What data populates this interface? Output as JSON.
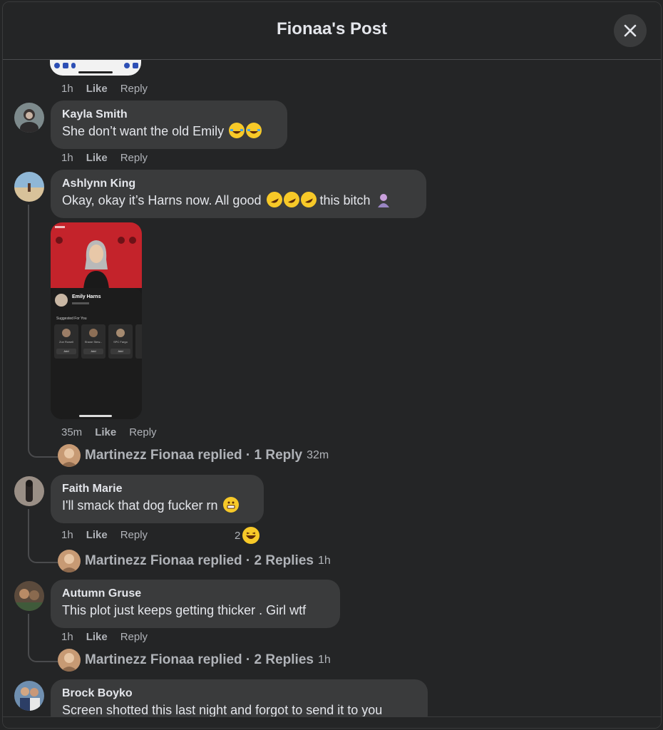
{
  "header": {
    "title": "Fionaa's Post"
  },
  "first_image_meta": {
    "time": "1h",
    "like": "Like",
    "reply": "Reply"
  },
  "comments": [
    {
      "author": "Kayla Smith",
      "text": "She don’t want the old Emily",
      "time": "1h",
      "like": "Like",
      "reply": "Reply"
    },
    {
      "author": "Ashlynn King",
      "text": "Okay, okay it’s Harns now. All good",
      "text_tail": "this bitch",
      "time": "35m",
      "like": "Like",
      "reply": "Reply",
      "screenshot": {
        "name": "Emily Harns",
        "section": "Suggested For You",
        "suggested": [
          "Zoe Rowell",
          "Shane Stew...",
          "SPC Fargo"
        ],
        "add": "Add"
      }
    },
    {
      "author": "Faith Marie",
      "text": "I'll smack that dog fucker rn",
      "time": "1h",
      "like": "Like",
      "reply": "Reply",
      "reaction_count": "2"
    },
    {
      "author": "Autumn Gruse",
      "text": "This plot just keeps getting thicker . Girl wtf",
      "time": "1h",
      "like": "Like",
      "reply": "Reply"
    },
    {
      "author": "Brock Boyko",
      "text": "Screen shotted this last night and forgot to send it to you"
    }
  ],
  "replies": [
    {
      "label": "Martinezz Fionaa replied · 1 Reply",
      "time": "32m"
    },
    {
      "label": "Martinezz Fionaa replied · 2 Replies",
      "time": "1h"
    },
    {
      "label": "Martinezz Fionaa replied · 2 Replies",
      "time": "1h"
    }
  ],
  "colors": {
    "background": "#242526",
    "bubble": "#3a3b3c",
    "text": "#e4e6eb",
    "muted": "#b0b3b8",
    "screenshot_red": "#c4232b"
  }
}
